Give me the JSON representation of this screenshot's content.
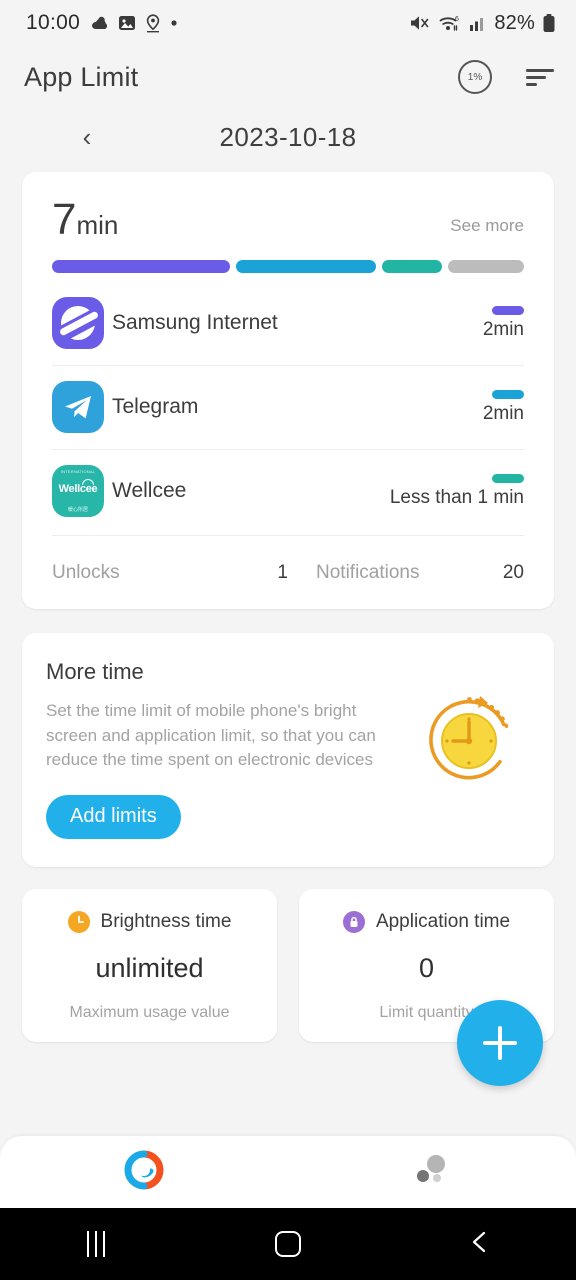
{
  "statusbar": {
    "time": "10:00",
    "battery_percent": "82%",
    "icons": [
      "weather-icon",
      "photos-icon",
      "location-icon",
      "dot-icon",
      "mute-icon",
      "wifi-icon",
      "signal-icon",
      "battery-icon"
    ]
  },
  "header": {
    "title": "App Limit",
    "badge_percent": "1%",
    "sort_icon": "sort-icon"
  },
  "date_nav": {
    "prev": "‹",
    "date": "2023-10-18"
  },
  "usage": {
    "total_value": "7",
    "total_unit": "min",
    "see_more": "See more",
    "segments": [
      {
        "name": "samsung-internet",
        "color": "#6b5ce7",
        "flex": 184
      },
      {
        "name": "telegram",
        "color": "#1ba3d8",
        "flex": 145
      },
      {
        "name": "wellcee",
        "color": "#23b5a3",
        "flex": 62
      },
      {
        "name": "other",
        "color": "#bcbcbc",
        "flex": 78
      }
    ],
    "apps": [
      {
        "name": "Samsung Internet",
        "value": "2min",
        "color": "#6b5ce7",
        "icon": "samsung-internet-icon"
      },
      {
        "name": "Telegram",
        "value": "2min",
        "color": "#1ba3d8",
        "icon": "telegram-icon"
      },
      {
        "name": "Wellcee",
        "value": "Less than 1 min",
        "color": "#23b5a3",
        "icon": "wellcee-icon"
      }
    ],
    "stats": {
      "unlocks_label": "Unlocks",
      "unlocks_value": "1",
      "notifications_label": "Notifications",
      "notifications_value": "20"
    }
  },
  "more_time": {
    "title": "More time",
    "description": "Set the time limit of mobile phone's bright screen and application limit, so that you can reduce the time spent on electronic devices",
    "button": "Add limits",
    "illustration": "clock-arrow-icon"
  },
  "mini_cards": [
    {
      "icon": "clock-icon",
      "icon_color": "#f5a623",
      "title": "Brightness time",
      "value": "unlimited",
      "subtitle": "Maximum usage value"
    },
    {
      "icon": "lock-icon",
      "icon_color": "#9b6fd4",
      "title": "Application time",
      "value": "0",
      "subtitle": "Limit quantity"
    }
  ],
  "fab": {
    "label": "+",
    "color": "#21b0ea",
    "name": "add-limit-fab"
  },
  "bottom_nav": [
    {
      "name": "statistics-tab",
      "icon": "donut-chart-icon",
      "active": true
    },
    {
      "name": "bubbles-tab",
      "icon": "bubbles-icon",
      "active": false
    }
  ],
  "android_nav": [
    {
      "name": "recents-button",
      "icon": "recents-icon"
    },
    {
      "name": "home-button",
      "icon": "home-icon"
    },
    {
      "name": "back-button",
      "icon": "back-icon"
    }
  ],
  "wellcee_icon_text": {
    "top": "INTERNATIONAL",
    "mid": "Wellcee",
    "bottom": "暖心所居"
  }
}
